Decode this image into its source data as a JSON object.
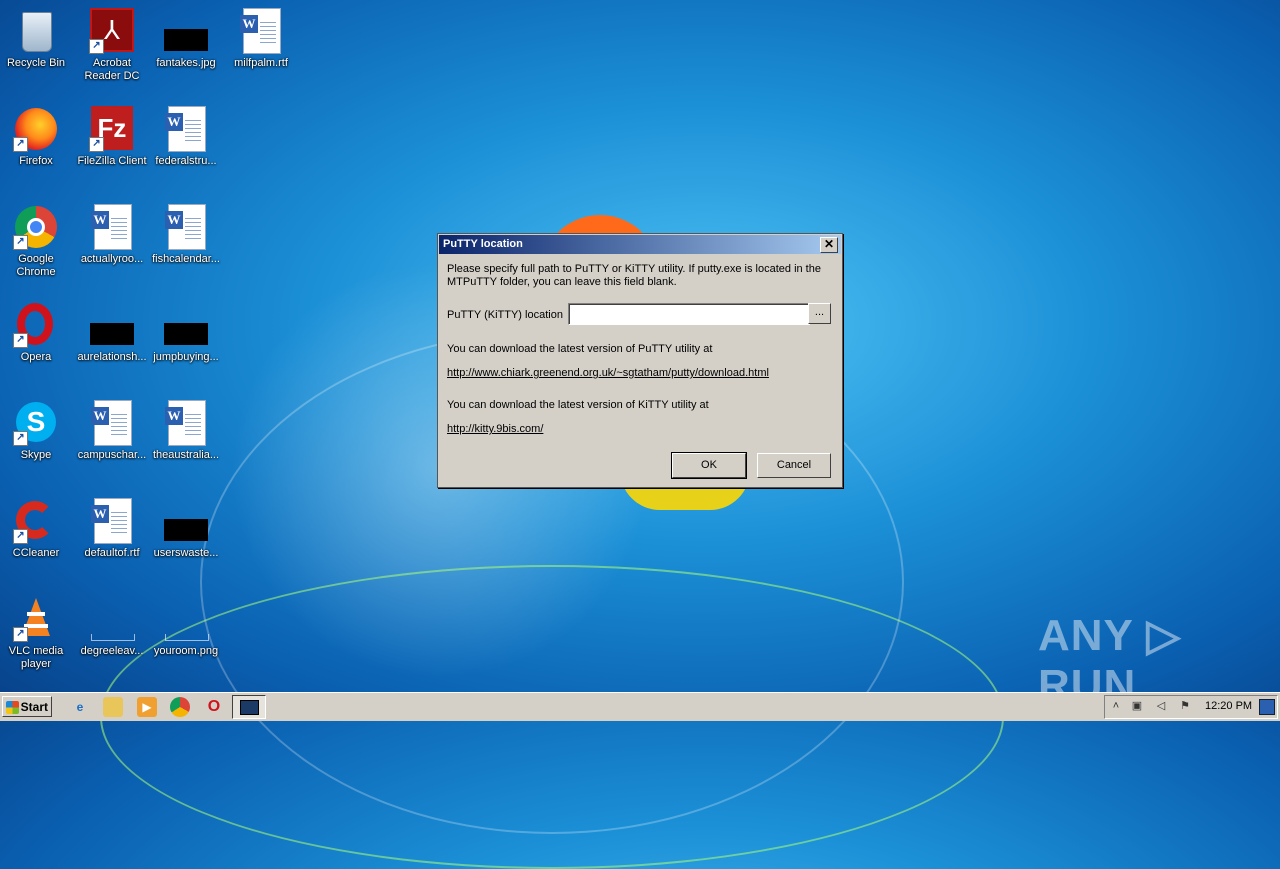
{
  "desktop": {
    "icons": [
      {
        "label": "Recycle Bin"
      },
      {
        "label": "Acrobat\nReader DC"
      },
      {
        "label": "fantakes.jpg"
      },
      {
        "label": "milfpalm.rtf"
      },
      {
        "label": "Firefox"
      },
      {
        "label": "FileZilla Client"
      },
      {
        "label": "federalstru..."
      },
      {
        "label": "Google\nChrome"
      },
      {
        "label": "actuallyroo..."
      },
      {
        "label": "fishcalendar..."
      },
      {
        "label": "Opera"
      },
      {
        "label": "aurelationsh..."
      },
      {
        "label": "jumpbuying..."
      },
      {
        "label": "Skype"
      },
      {
        "label": "campuschar..."
      },
      {
        "label": "theaustralia..."
      },
      {
        "label": "CCleaner"
      },
      {
        "label": "defaultof.rtf"
      },
      {
        "label": "userswaste..."
      },
      {
        "label": "VLC media\nplayer"
      },
      {
        "label": "degreeleav..."
      },
      {
        "label": "youroom.png"
      }
    ]
  },
  "dialog": {
    "title": "PuTTY location",
    "close_glyph": "✕",
    "intro": "Please specify full path to PuTTY or KiTTY utility. If putty.exe is located in the MTPuTTY folder, you can leave this field blank.",
    "location_label": "PuTTY (KiTTY) location",
    "location_value": "",
    "browse_label": "...",
    "putty_text": "You can download the latest version of PuTTY utility at",
    "putty_link": "http://www.chiark.greenend.org.uk/~sgtatham/putty/download.html",
    "kitty_text": "You can download the latest version of KiTTY utility at",
    "kitty_link": "http://kitty.9bis.com/",
    "ok_label": "OK",
    "cancel_label": "Cancel"
  },
  "taskbar": {
    "start_label": "Start",
    "clock": "12:20 PM"
  },
  "watermark": "ANY ▷ RUN",
  "colors": {
    "title_gradient_start": "#0a246a",
    "title_gradient_end": "#a6caf0",
    "dialog_face": "#d4d0c8"
  }
}
